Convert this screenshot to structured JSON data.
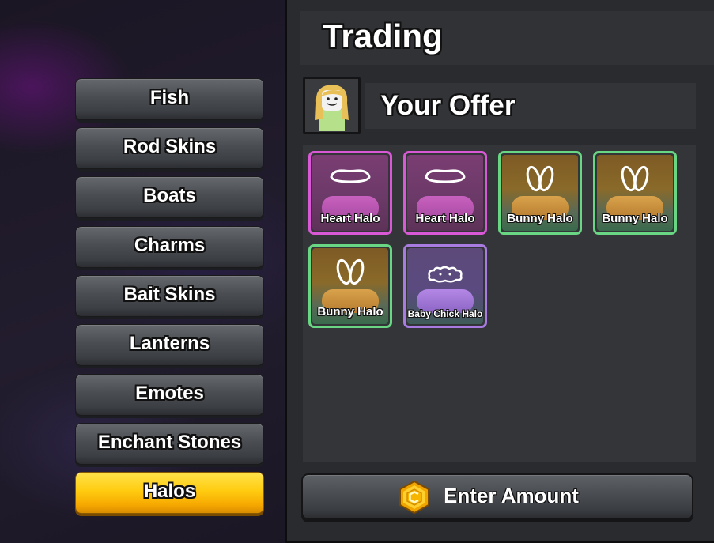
{
  "sidebar": {
    "categories": [
      {
        "label": "Fish"
      },
      {
        "label": "Rod Skins"
      },
      {
        "label": "Boats"
      },
      {
        "label": "Charms"
      },
      {
        "label": "Bait Skins"
      },
      {
        "label": "Lanterns"
      },
      {
        "label": "Emotes"
      },
      {
        "label": "Enchant Stones"
      },
      {
        "label": "Halos"
      }
    ],
    "active_index": 8
  },
  "panel": {
    "title": "Trading",
    "offer_label": "Your Offer",
    "items": [
      {
        "name": "Heart Halo",
        "rarity": "pink",
        "icon": "heart-halo-icon"
      },
      {
        "name": "Heart Halo",
        "rarity": "pink",
        "icon": "heart-halo-icon"
      },
      {
        "name": "Bunny Halo",
        "rarity": "green",
        "icon": "bunny-halo-icon"
      },
      {
        "name": "Bunny Halo",
        "rarity": "green",
        "icon": "bunny-halo-icon"
      },
      {
        "name": "Bunny Halo",
        "rarity": "green",
        "icon": "bunny-halo-icon"
      },
      {
        "name": "Baby Chick Halo",
        "rarity": "purple",
        "icon": "baby-chick-halo-icon"
      }
    ],
    "enter_amount_label": "Enter Amount",
    "coin_icon": "coin-icon"
  },
  "colors": {
    "active_tab": "#ffcc10",
    "pink_rarity": "#d958d6",
    "green_rarity": "#69d683",
    "purple_rarity": "#a77be0"
  }
}
